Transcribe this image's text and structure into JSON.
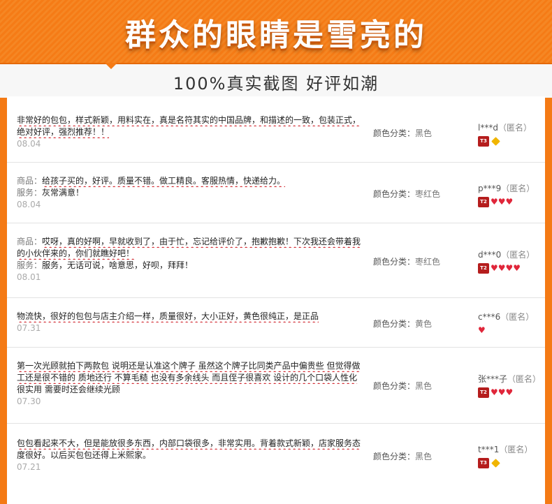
{
  "header": {
    "title": "群众的眼睛是雪亮的",
    "subtitle": "100%真实截图 好评如潮"
  },
  "labels": {
    "color_label": "颜色分类：",
    "product_label": "商品：",
    "service_label": "服务："
  },
  "colors": {
    "accent": "#f47a15",
    "underline": "#d0232b",
    "rank_badge": "#b51d1d"
  },
  "reviews": [
    {
      "lines": [
        "非常好的包包，样式新颖，用料实在，真是名符其实的中国品牌，和描述的一致，包装正式，",
        "绝对好评，强烈推荐！！"
      ],
      "date": "08.04",
      "color": "黑色",
      "user": "l***d",
      "anon": "（匿名）",
      "rank_badge": "T3",
      "gems": "diamond"
    },
    {
      "product": "给孩子买的，好评。质量不错。做工精良。客服热情，快递给力。",
      "service": "灰常满意！",
      "date": "08.04",
      "color": "枣红色",
      "user": "p***9",
      "anon": "（匿名）",
      "rank_badge": "T2",
      "gems": "♥♥♥"
    },
    {
      "product": "哎呀，真的好啊，早就收到了，由于忙，忘记给评价了，抱歉抱歉！下次我还会带着我的小伙伴来的，你们就瞧好吧！",
      "product_line1": "哎呀，真的好啊，早就收到了，由于忙，忘记给评价了，抱歉抱歉！下次我还会带着我",
      "product_line2": "的小伙伴来的，你们就瞧好吧！",
      "service": "服务，无话可说，啥意思，好呗，拜拜！",
      "date": "08.01",
      "color": "枣红色",
      "user": "d***0",
      "anon": "（匿名）",
      "rank_badge": "T2",
      "gems": "♥♥♥♥"
    },
    {
      "lines": [
        "物流快，很好的包包与店主介绍一样，质量很好，大小正好，黄色很纯正，是正品"
      ],
      "date": "07.31",
      "color": "黄色",
      "user": "c***6",
      "anon": "（匿名）",
      "rank_badge": "",
      "gems": "♥"
    },
    {
      "lines": [
        "第一次光顾就拍下两款包 说明还是认准这个牌子 虽然这个牌子比同类产品中偏贵些 但觉得做",
        "工还是很不错的 质地还行 不算毛糙 也没有多余线头 而且侄子很喜欢 设计的几个口袋人性化",
        "很实用 需要时还会继续光顾"
      ],
      "date": "07.30",
      "color": "黑色",
      "user": "张***子",
      "anon": "（匿名）",
      "rank_badge": "T2",
      "gems": "♥♥♥"
    },
    {
      "lines": [
        "包包看起来不大，但是能放很多东西，内部口袋很多，非常实用。背着款式新颖，店家服务态",
        "度很好。以后买包包还得上米熙家。"
      ],
      "date": "07.21",
      "color": "黑色",
      "user": "t***1",
      "anon": "（匿名）",
      "rank_badge": "T3",
      "gems": "diamond"
    }
  ]
}
